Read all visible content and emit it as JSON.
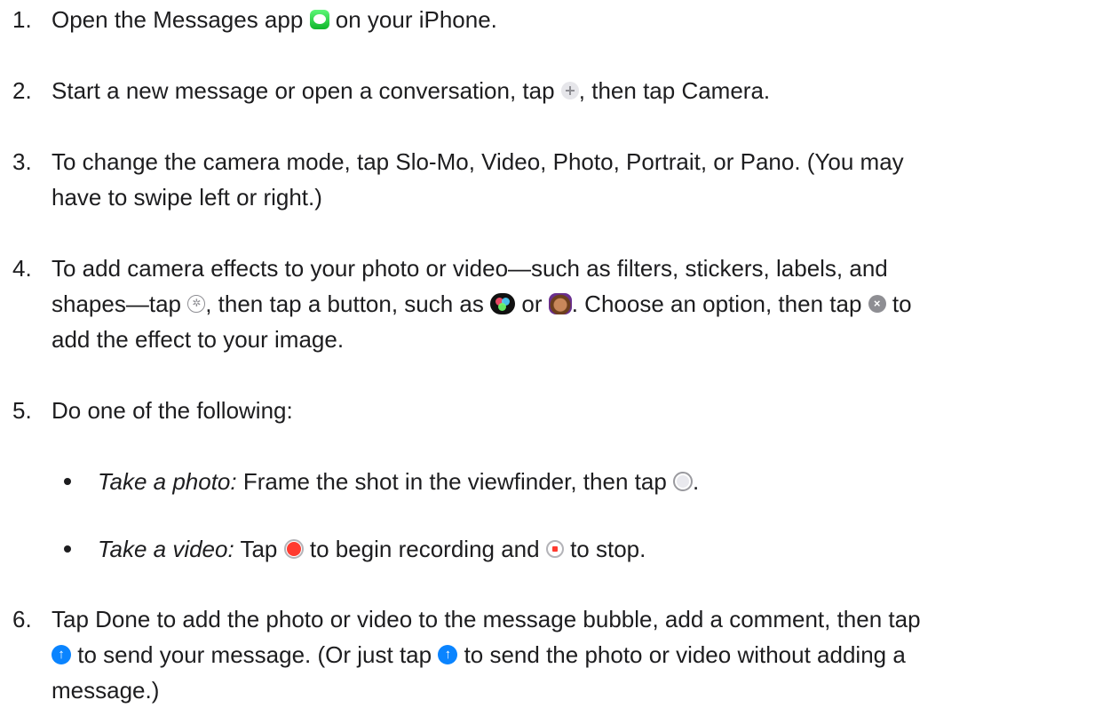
{
  "steps": [
    {
      "number": "1.",
      "text_before": "Open the Messages app",
      "icon": "messages-app-icon",
      "text_after": "on your iPhone."
    },
    {
      "number": "2.",
      "text_before": "Start a new message or open a conversation, tap",
      "icon": "plus-circle-icon",
      "text_after": ", then tap Camera."
    },
    {
      "number": "3.",
      "line1": "To change the camera mode, tap Slo-Mo, Video, Photo, Portrait, or Pano. (You may",
      "line2": "have to swipe left or right.)"
    },
    {
      "number": "4.",
      "line1": "To add camera effects to your photo or video—such as filters, stickers, labels, and",
      "line2_a": "shapes—tap",
      "line2_b": ", then tap a button, such as",
      "line2_c": "or",
      "line2_d": ". Choose an option, then tap",
      "line2_e": "to",
      "line3": "add the effect to your image.",
      "icons": [
        "effects-icon",
        "filters-icon",
        "memoji-icon",
        "close-icon"
      ]
    },
    {
      "number": "5.",
      "text": "Do one of the following:",
      "bullets": [
        {
          "label": "Take a photo:",
          "text_before": "Frame the shot in the viewfinder, then tap",
          "icon": "shutter-icon",
          "text_after": "."
        },
        {
          "label": "Take a video:",
          "text_before": "Tap",
          "icon1": "record-icon",
          "text_middle": "to begin recording and",
          "icon2": "stop-icon",
          "text_after": "to stop."
        }
      ]
    },
    {
      "number": "6.",
      "line1": "Tap Done to add the photo or video to the message bubble, add a comment, then tap",
      "line2_a": "to send your message. (Or just tap",
      "line2_b": "to send the photo or video without adding a",
      "line3": "message.)",
      "icon": "send-arrow-icon"
    }
  ],
  "colors": {
    "text": "#1d1d1f",
    "send_blue": "#0a84ff",
    "record_red": "#ff3b30",
    "messages_green": "#34c759"
  }
}
